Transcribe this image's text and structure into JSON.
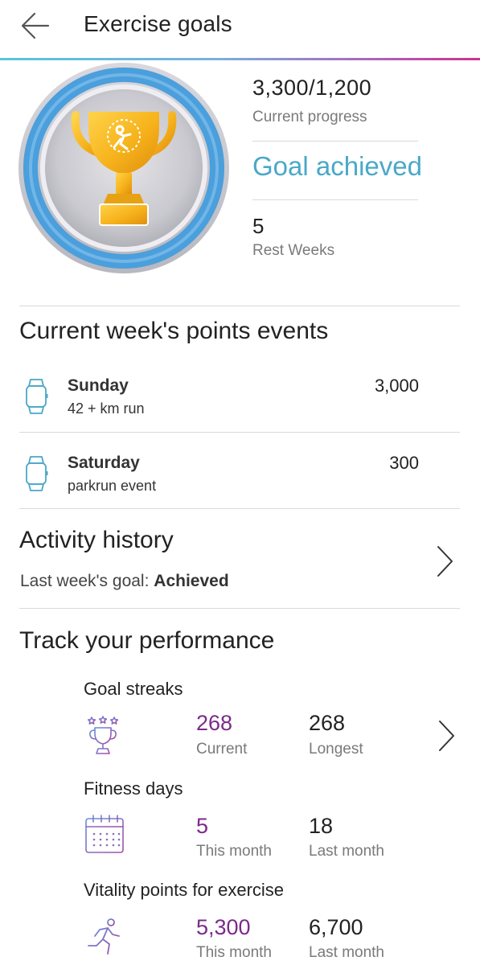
{
  "header": {
    "title": "Exercise goals"
  },
  "goal": {
    "progress_current": "3,300",
    "progress_separator": "/",
    "progress_target": "1,200",
    "progress_label": "Current progress",
    "status": "Goal achieved",
    "rest_weeks_value": "5",
    "rest_weeks_label": "Rest Weeks"
  },
  "events": {
    "title": "Current week's points events",
    "items": [
      {
        "day": "Sunday",
        "description": "42 + km run",
        "points": "3,000"
      },
      {
        "day": "Saturday",
        "description": "parkrun event",
        "points": "300"
      }
    ]
  },
  "activity": {
    "title": "Activity history",
    "last_week_label": "Last week's goal:",
    "last_week_value": "Achieved"
  },
  "performance": {
    "title": "Track your performance",
    "streaks": {
      "title": "Goal streaks",
      "current_value": "268",
      "current_label": "Current",
      "longest_value": "268",
      "longest_label": "Longest"
    },
    "fitness": {
      "title": "Fitness days",
      "this_month_value": "5",
      "this_month_label": "This month",
      "last_month_value": "18",
      "last_month_label": "Last month"
    },
    "points": {
      "title": "Vitality points for exercise",
      "this_month_value": "5,300",
      "this_month_label": "This month",
      "last_month_value": "6,700",
      "last_month_label": "Last month"
    }
  },
  "colors": {
    "accent_blue": "#4aa8c8",
    "accent_purple": "#7b2a8a",
    "trophy_gold": "#f2b01e",
    "ring_blue": "#4a9fdc"
  },
  "icons": [
    "back-arrow-icon",
    "trophy-icon",
    "watch-icon",
    "chevron-right-icon",
    "trophy-stars-icon",
    "calendar-icon",
    "runner-icon"
  ]
}
